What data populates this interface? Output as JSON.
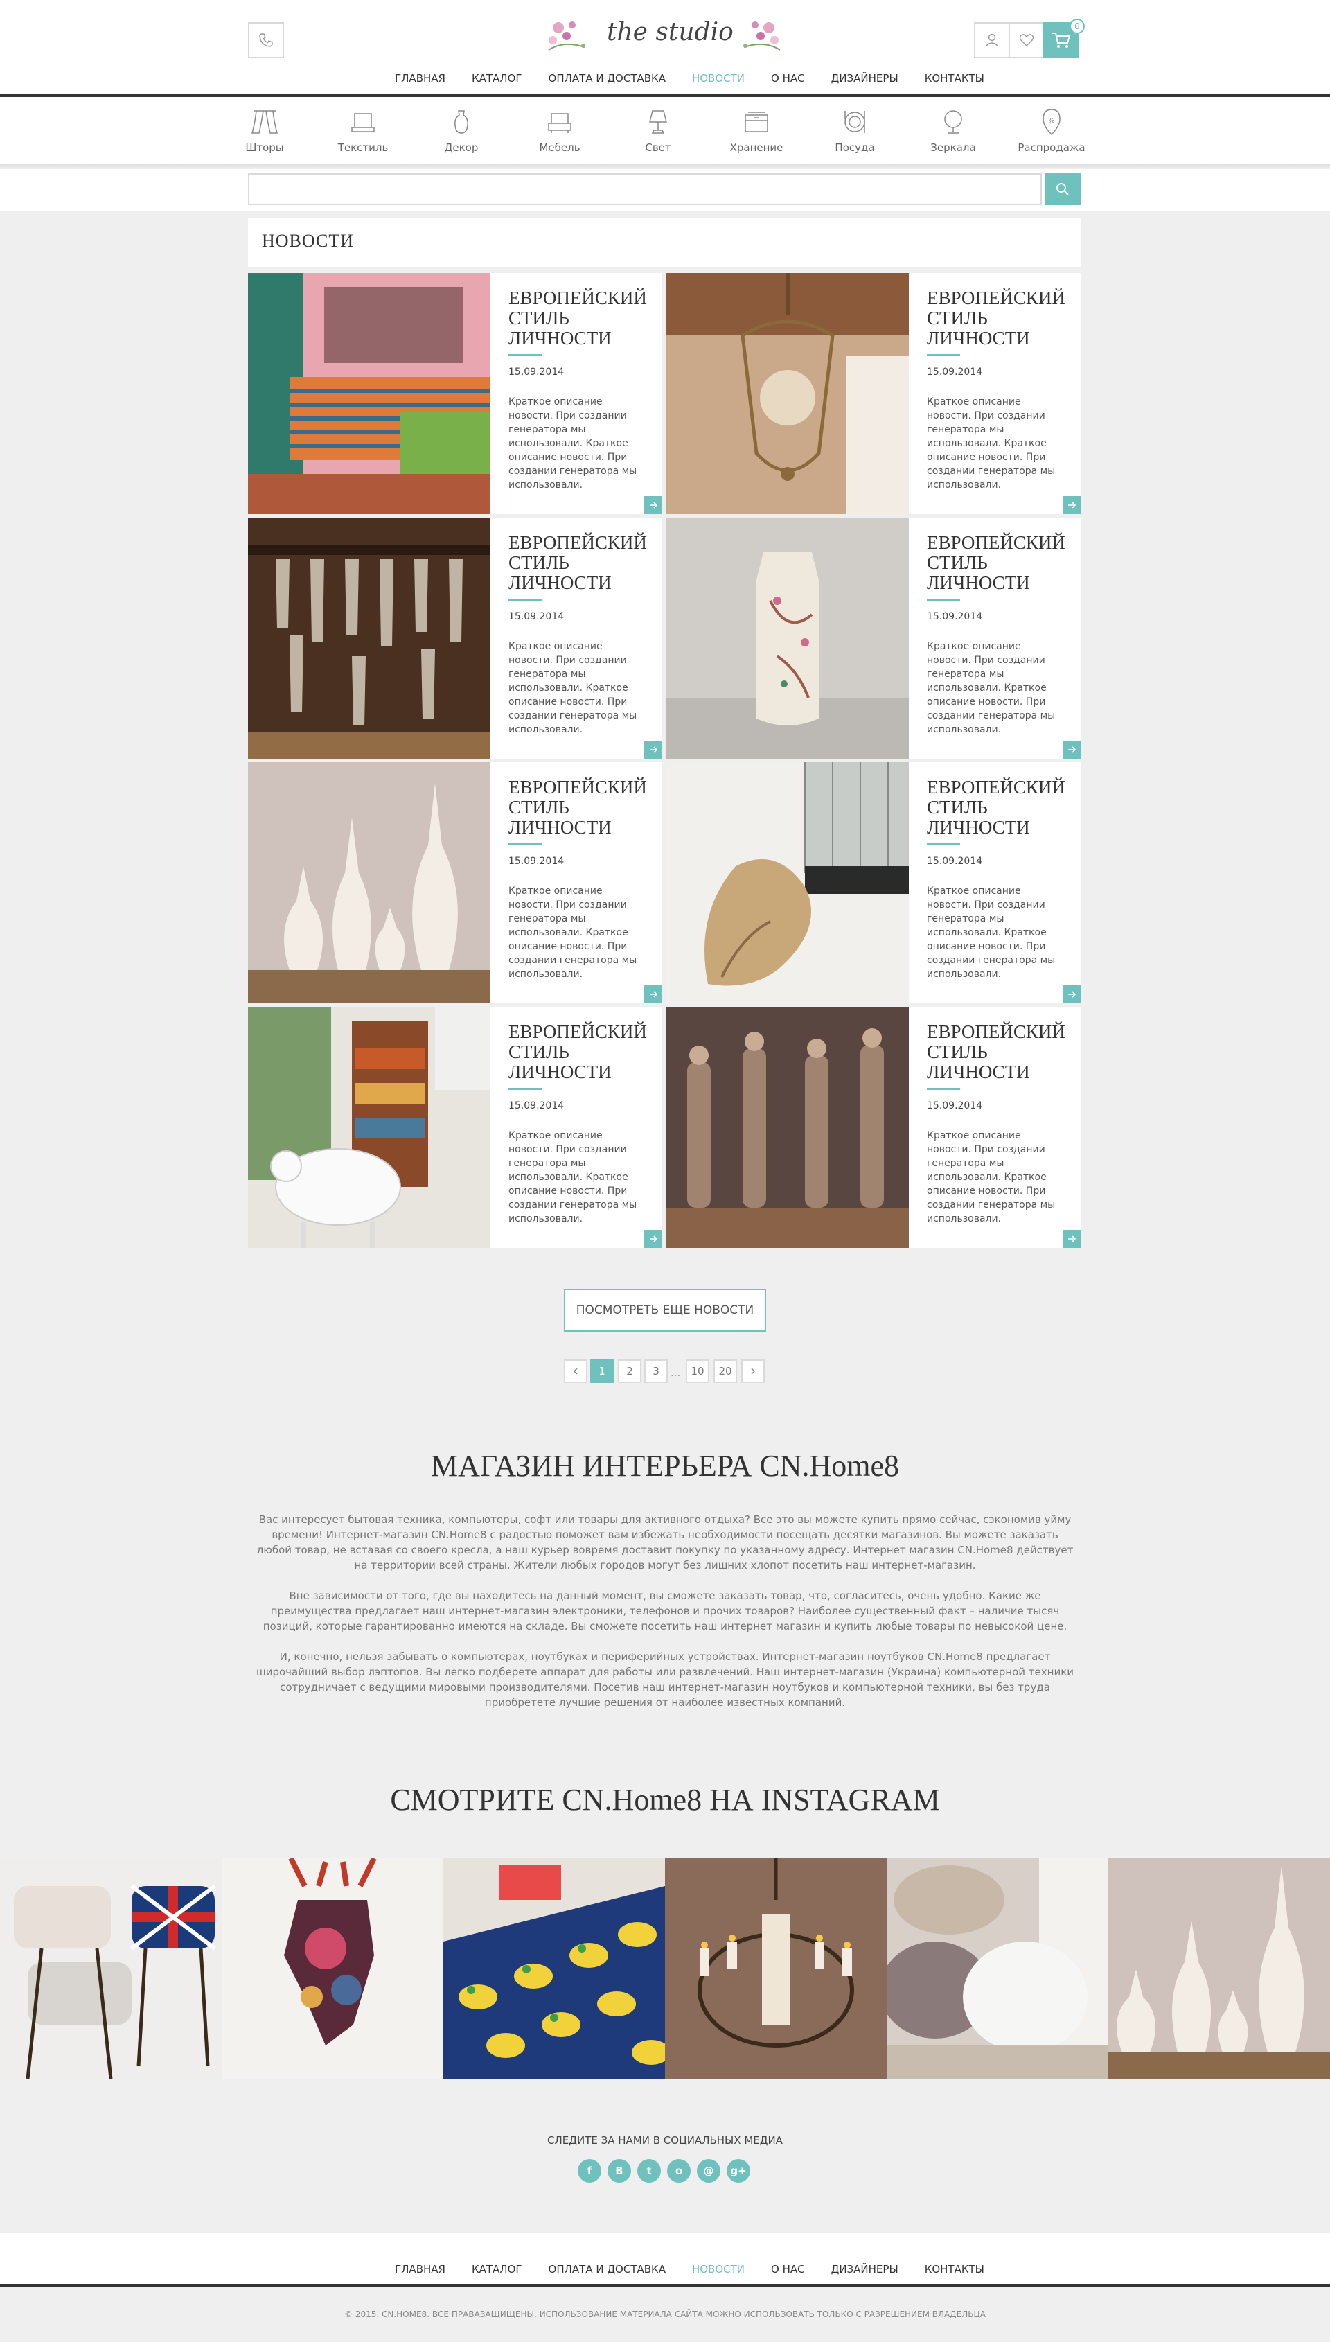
{
  "brand": {
    "logo_text": "the studio",
    "cart_count": "0"
  },
  "nav": [
    "Главная",
    "Каталог",
    "Оплата и доставка",
    "Новости",
    "О нас",
    "Дизайнеры",
    "Контакты"
  ],
  "nav_active": "Новости",
  "categories": [
    {
      "label": "Шторы",
      "icon": "curtains-icon"
    },
    {
      "label": "Текстиль",
      "icon": "textile-icon"
    },
    {
      "label": "Декор",
      "icon": "vase-icon"
    },
    {
      "label": "Мебель",
      "icon": "armchair-icon"
    },
    {
      "label": "Свет",
      "icon": "lamp-icon"
    },
    {
      "label": "Хранение",
      "icon": "storage-box-icon"
    },
    {
      "label": "Посуда",
      "icon": "dishes-icon"
    },
    {
      "label": "Зеркала",
      "icon": "mirror-icon"
    },
    {
      "label": "Распродажа",
      "icon": "sale-tag-icon"
    }
  ],
  "search": {
    "placeholder": ""
  },
  "news": {
    "title": "НОВОСТИ",
    "items": [
      {
        "title": "ЕВРОПЕЙСКИЙ СТИЛЬ ЛИЧНОСТИ",
        "date": "15.09.2014",
        "desc": "Краткое описание новости. При создании генератора мы использовали. Краткое описание новости. При создании генератора мы использовали.",
        "photo": "bedroom-photo"
      },
      {
        "title": "ЕВРОПЕЙСКИЙ СТИЛЬ ЛИЧНОСТИ",
        "date": "15.09.2014",
        "desc": "Краткое описание новости. При создании генератора мы использовали. Краткое описание новости. При создании генератора мы использовали.",
        "photo": "chandelier-photo"
      },
      {
        "title": "ЕВРОПЕЙСКИЙ СТИЛЬ ЛИЧНОСТИ",
        "date": "15.09.2014",
        "desc": "Краткое описание новости. При создании генератора мы использовали. Краткое описание новости. При создании генератора мы использовали.",
        "photo": "glass-rack-photo"
      },
      {
        "title": "ЕВРОПЕЙСКИЙ СТИЛЬ ЛИЧНОСТИ",
        "date": "15.09.2014",
        "desc": "Краткое описание новости. При создании генератора мы использовали. Краткое описание новости. При создании генератора мы использовали.",
        "photo": "vase-photo"
      },
      {
        "title": "ЕВРОПЕЙСКИЙ СТИЛЬ ЛИЧНОСТИ",
        "date": "15.09.2014",
        "desc": "Краткое описание новости. При создании генератора мы использовали. Краткое описание новости. При создании генератора мы использовали.",
        "photo": "white-vases-photo"
      },
      {
        "title": "ЕВРОПЕЙСКИЙ СТИЛЬ ЛИЧНОСТИ",
        "date": "15.09.2014",
        "desc": "Краткое описание новости. При создании генератора мы использовали. Краткое описание новости. При создании генератора мы использовали.",
        "photo": "lounge-chair-photo"
      },
      {
        "title": "ЕВРОПЕЙСКИЙ СТИЛЬ ЛИЧНОСТИ",
        "date": "15.09.2014",
        "desc": "Краткое описание новости. При создании генератора мы использовали. Краткое описание новости. При создании генератора мы использовали.",
        "photo": "sheep-shelf-photo"
      },
      {
        "title": "ЕВРОПЕЙСКИЙ СТИЛЬ ЛИЧНОСТИ",
        "date": "15.09.2014",
        "desc": "Краткое описание новости. При создании генератора мы использовали. Краткое описание новости. При создании генератора мы использовали.",
        "photo": "figurines-photo"
      }
    ],
    "more_label": "Посмотреть еще новости"
  },
  "pagination": {
    "pages": [
      "1",
      "2",
      "3",
      "10",
      "20"
    ],
    "active": "1",
    "ellipsis": "..."
  },
  "shop": {
    "title": "МАГАЗИН ИНТЕРЬЕРА CN.Home8",
    "p1": "Вас интересует бытовая техника, компьютеры, софт или товары для активного отдыха? Все это вы можете купить прямо сейчас, сэкономив уйму времени! Интернет-магазин CN.Home8 с радостью поможет вам избежать необходимости посещать десятки магазинов. Вы можете заказать любой товар, не вставая со своего кресла, а наш курьер вовремя доставит покупку по указанному адресу. Интернет магазин CN.Home8 действует на территории всей страны. Жители любых городов могут без лишних хлопот посетить наш интернет-магазин.",
    "p2": "Вне зависимости от того, где вы находитесь на данный момент, вы сможете заказать товар, что, согласитесь, очень удобно. Какие же преимущества предлагает наш интернет-магазин электроники, телефонов и прочих товаров? Наиболее существенный факт – наличие тысяч позиций, которые гарантированно имеются на складе. Вы сможете посетить наш интернет магазин и купить любые товары по невысокой цене.",
    "p3": "И, конечно, нельзя забывать о компьютерах, ноутбуках и периферийных устройствах. Интернет-магазин ноутбуков CN.Home8 предлагает широчайший выбор лэптопов. Вы легко подберете аппарат для работы или развлечений. Наш интернет-магазин (Украина) компьютерной техники сотрудничает с ведущими мировыми производителями. Посетив наш интернет-магазин ноутбуков и компьютерной техники, вы без труда приобретете лучшие решения от наиболее известных компаний."
  },
  "instagram": {
    "title": "СМОТРИТЕ CN.Home8 НА INSTAGRAM",
    "photos": [
      "flag-stools-photo",
      "deer-head-photo",
      "strawberry-fabric-photo",
      "candle-chandelier-photo",
      "fur-pillows-photo",
      "white-vases-photo"
    ]
  },
  "social": {
    "title": "Следите за нами в социальных медиа",
    "items": [
      {
        "icon": "facebook-icon",
        "glyph": "f"
      },
      {
        "icon": "vk-icon",
        "glyph": "В"
      },
      {
        "icon": "twitter-icon",
        "glyph": "t"
      },
      {
        "icon": "odnoklassniki-icon",
        "glyph": "о"
      },
      {
        "icon": "email-icon",
        "glyph": "@"
      },
      {
        "icon": "google-plus-icon",
        "glyph": "g+"
      }
    ]
  },
  "footer": {
    "copyright": "© 2015. CN.HOME8. ВСЕ ПРАВАЗАЩИЩЕНЫ. ИСПОЛЬЗОВАНИЕ МАТЕРИАЛА САЙТА МОЖНО ИСПОЛЬЗОВАТЬ ТОЛЬКО С РАЗРЕШЕНИЕМ ВЛАДЕЛЬЦА"
  },
  "colors": {
    "accent": "#6ec1bc",
    "dark": "#333333",
    "background": "#efefef"
  }
}
